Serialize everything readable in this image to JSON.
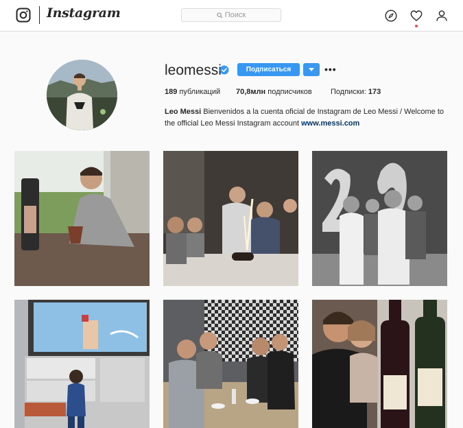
{
  "nav": {
    "brand": "Instagram",
    "search_placeholder": "Поиск",
    "icons": [
      "instagram-logo-icon",
      "search-icon",
      "compass-icon",
      "heart-icon",
      "user-icon"
    ],
    "notification_dot_color": "#ed4956"
  },
  "profile": {
    "username": "leomessi",
    "verified": true,
    "follow_label": "Подписаться",
    "posts_count": "189",
    "posts_label": "публикаций",
    "followers_count": "70,8млн",
    "followers_label": "подписчиков",
    "following_label": "Подписки:",
    "following_count": "173",
    "bio_name": "Leo Messi",
    "bio_text": " Bienvenidos a la cuenta oficial de Instagram de Leo Messi / Welcome to the official Leo Messi Instagram account ",
    "bio_link": "www.messi.com"
  },
  "colors": {
    "accent": "#3897f0",
    "link": "#003569",
    "background": "#fafafa",
    "border": "#dbdbdb"
  },
  "posts": [
    {
      "subject": "man-with-mate-cup"
    },
    {
      "subject": "birthday-candles"
    },
    {
      "subject": "balloons-29-bw"
    },
    {
      "subject": "child-watching-tv"
    },
    {
      "subject": "friends-at-table"
    },
    {
      "subject": "wine-bottles-selfie"
    }
  ]
}
